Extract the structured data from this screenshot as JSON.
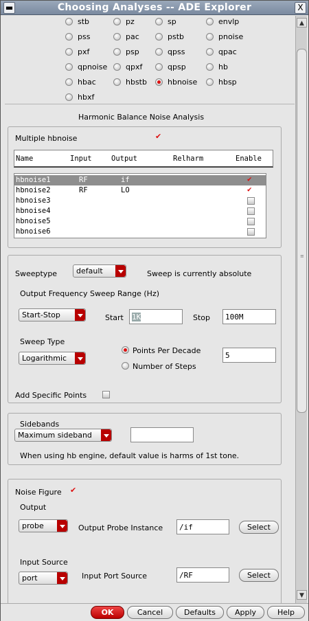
{
  "window": {
    "title": "Choosing Analyses -- ADE Explorer",
    "close_glyph": "X"
  },
  "analyses": {
    "options": [
      [
        "stb",
        "pz",
        "sp",
        "envlp"
      ],
      [
        "pss",
        "pac",
        "pstb",
        "pnoise"
      ],
      [
        "pxf",
        "psp",
        "qpss",
        "qpac"
      ],
      [
        "qpnoise",
        "qpxf",
        "qpsp",
        "hb"
      ],
      [
        "hbac",
        "hbstb",
        "hbnoise",
        "hbsp"
      ],
      [
        "hbxf"
      ]
    ],
    "selected": "hbnoise"
  },
  "section_title": "Harmonic Balance Noise Analysis",
  "multiple": {
    "label": "Multiple hbnoise",
    "checked": true,
    "headers": [
      "Name",
      "Input",
      "Output",
      "Relharm",
      "Enable"
    ],
    "rows": [
      {
        "name": "hbnoise1",
        "input": "RF",
        "output": "if",
        "relharm": "",
        "enable": true
      },
      {
        "name": "hbnoise2",
        "input": "RF",
        "output": "LO",
        "relharm": "",
        "enable": true
      },
      {
        "name": "hbnoise3",
        "input": "",
        "output": "",
        "relharm": "",
        "enable": false
      },
      {
        "name": "hbnoise4",
        "input": "",
        "output": "",
        "relharm": "",
        "enable": false
      },
      {
        "name": "hbnoise5",
        "input": "",
        "output": "",
        "relharm": "",
        "enable": false
      },
      {
        "name": "hbnoise6",
        "input": "",
        "output": "",
        "relharm": "",
        "enable": false
      }
    ]
  },
  "sweep": {
    "sweeptype_label": "Sweeptype",
    "sweeptype_value": "default",
    "sweep_status": "Sweep is currently absolute",
    "range_label": "Output Frequency Sweep Range (Hz)",
    "range_mode": "Start-Stop",
    "start_label": "Start",
    "start_value": "1K",
    "stop_label": "Stop",
    "stop_value": "100M",
    "sweep_type_label": "Sweep Type",
    "sweep_type_value": "Logarithmic",
    "points_per_decade_label": "Points Per Decade",
    "number_of_steps_label": "Number of Steps",
    "points_value": "5",
    "add_points_label": "Add Specific Points"
  },
  "sidebands": {
    "label": "Sidebands",
    "mode": "Maximum sideband",
    "value": "",
    "note": "When using hb engine, default value is harms of 1st tone."
  },
  "noise_figure": {
    "label": "Noise Figure",
    "checked": true,
    "output_label": "Output",
    "output_mode": "probe",
    "output_probe_label": "Output Probe Instance",
    "output_probe_value": "/if",
    "select_label": "Select",
    "input_source_label": "Input Source",
    "input_mode": "port",
    "input_port_label": "Input Port Source",
    "input_port_value": "/RF"
  },
  "buttons": {
    "ok": "OK",
    "cancel": "Cancel",
    "defaults": "Defaults",
    "apply": "Apply",
    "help": "Help"
  }
}
